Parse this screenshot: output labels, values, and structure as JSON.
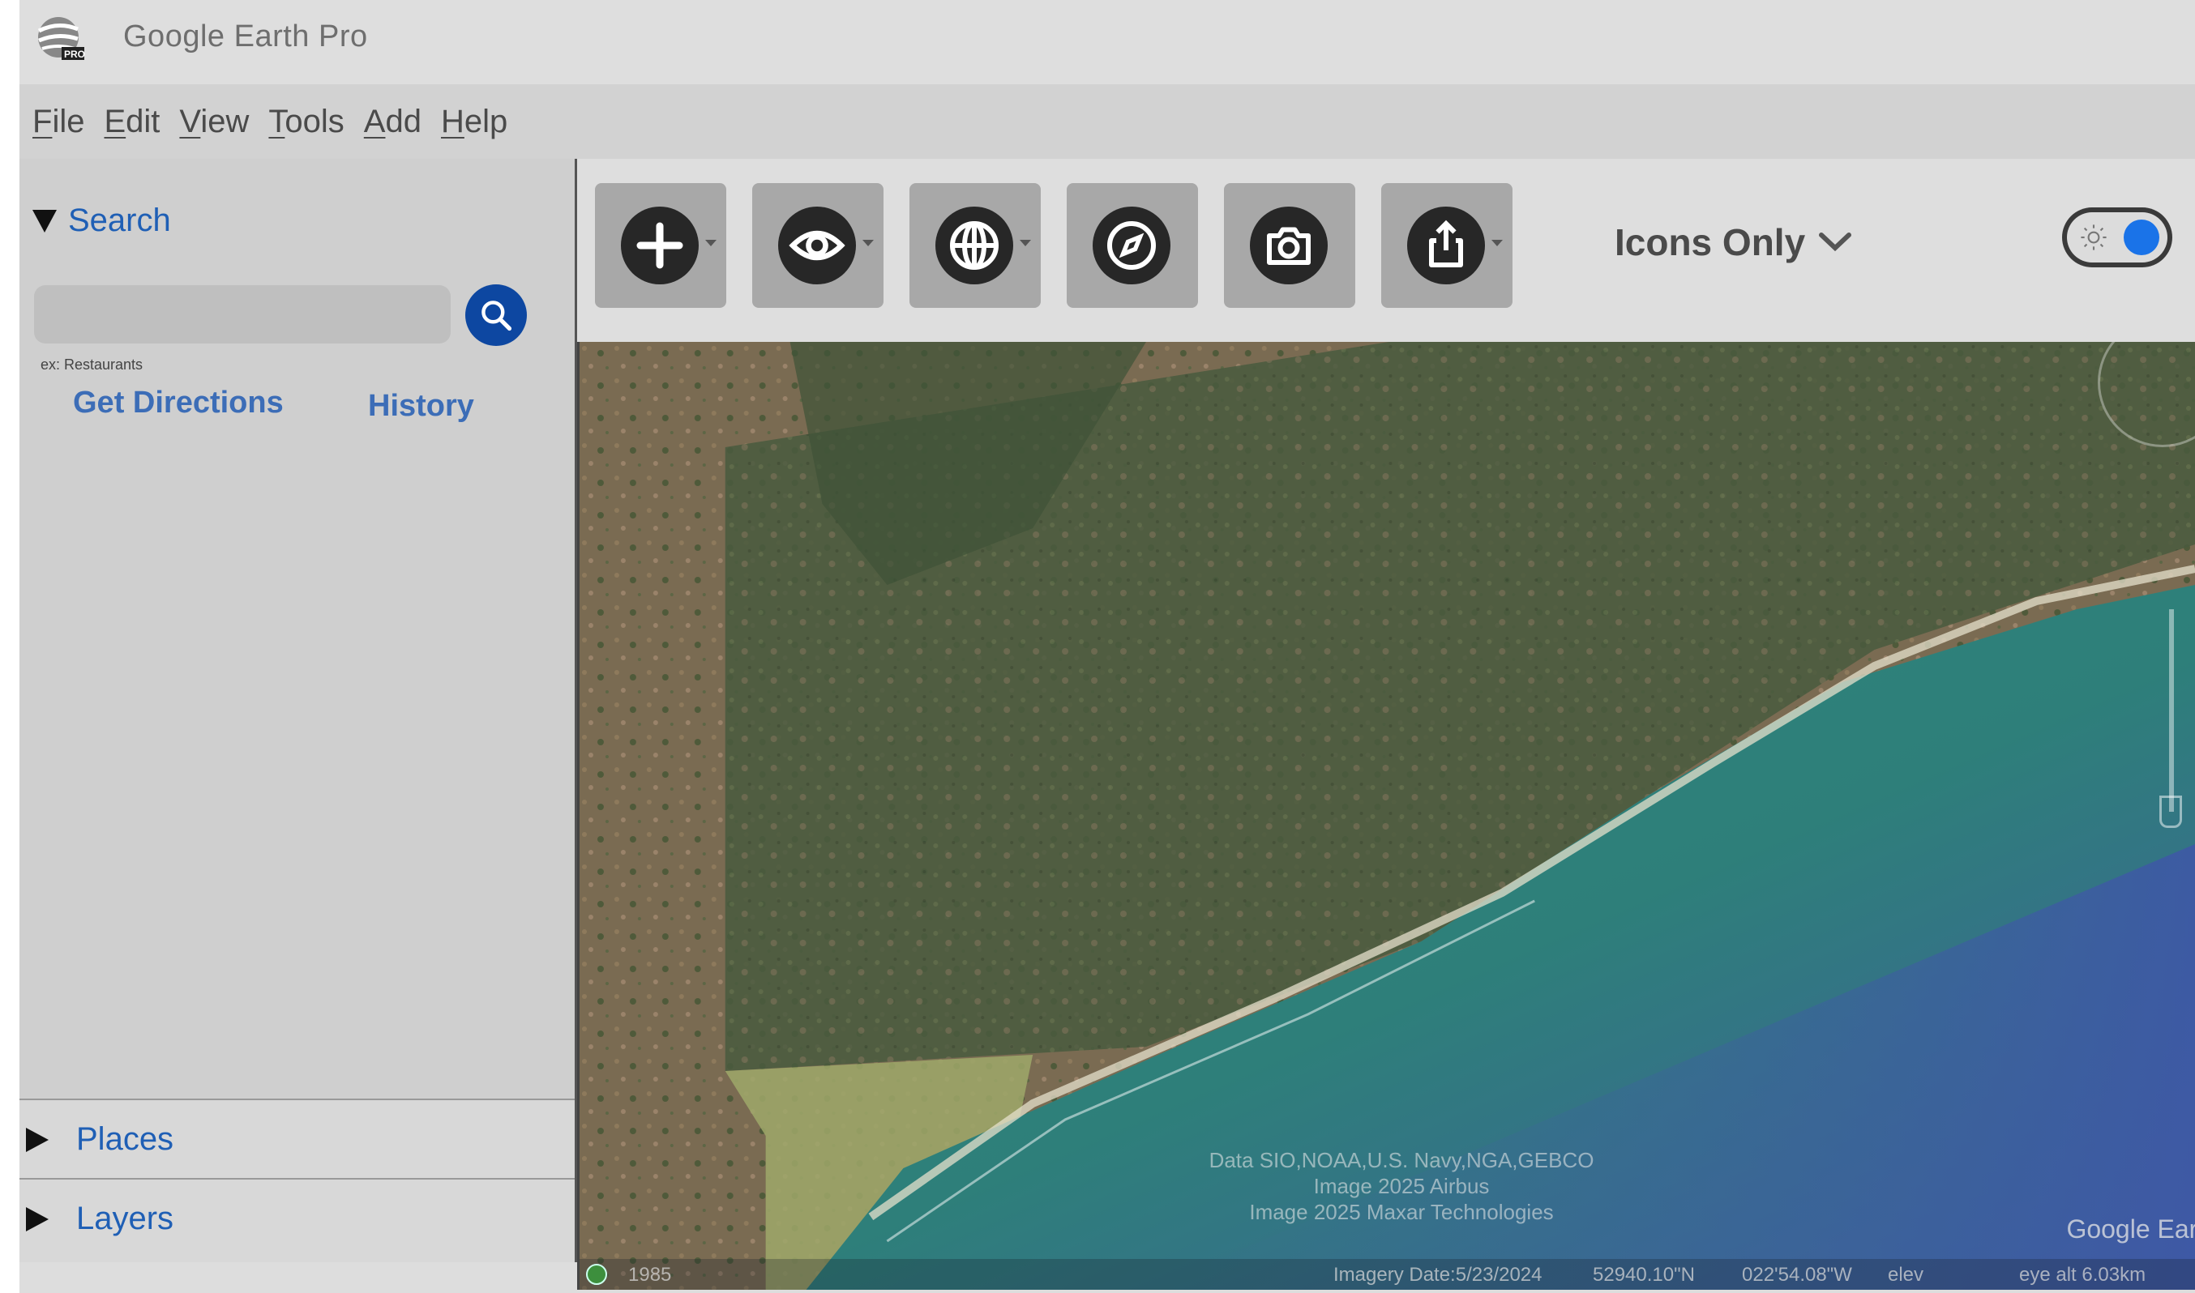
{
  "window": {
    "title": "Google Earth Pro"
  },
  "menu": [
    {
      "mnemonic": "F",
      "rest": "ile"
    },
    {
      "mnemonic": "E",
      "rest": "dit"
    },
    {
      "mnemonic": "V",
      "rest": "iew"
    },
    {
      "mnemonic": "T",
      "rest": "ools"
    },
    {
      "mnemonic": "A",
      "rest": "dd"
    },
    {
      "mnemonic": "H",
      "rest": "elp"
    }
  ],
  "toolbar": {
    "buttons": [
      "add-icon",
      "eye-icon",
      "globe-icon",
      "compass-icon",
      "camera-icon",
      "share-icon"
    ],
    "view_mode": "Icons Only",
    "theme_toggle_on": true
  },
  "search": {
    "title": "Search",
    "input_value": "",
    "hint": "ex: Restaurants",
    "tab_directions": "Get Directions",
    "tab_history": "History"
  },
  "panels": {
    "places": "Places",
    "layers": "Layers"
  },
  "map": {
    "attribution": [
      "Data SIO,NOAA,U.S. Navy,NGA,GEBCO",
      "Image  2025 Airbus",
      "Image 2025 Maxar Technologies"
    ],
    "logo": "Google Earth",
    "status": {
      "year": "1985",
      "imagery_date": "Imagery Date:5/23/2024",
      "lat": "52940.10\"N",
      "lon": "022'54.08\"W",
      "elev": "elev",
      "eye_alt": "eye alt  6.03km"
    }
  },
  "colors": {
    "accent_blue": "#1f5fb5",
    "search_button": "#0d47a1",
    "toggle_knob": "#1a73e8"
  }
}
